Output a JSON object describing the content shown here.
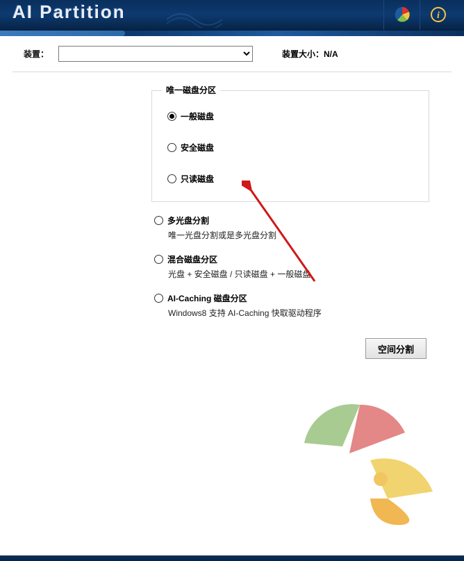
{
  "header": {
    "title": "AI Partition",
    "pie_icon_colors": {
      "r": "#d33",
      "y": "#f5c63f",
      "g": "#7fbf4f",
      "b": "#1e5a9e"
    },
    "info_icon_label": "i"
  },
  "device": {
    "label": "装置：",
    "selected_value": "",
    "size_label": "装置大小：",
    "size_value": "N/A"
  },
  "single_partition": {
    "legend": "唯一磁盘分区",
    "options": [
      {
        "label": "一般磁盘",
        "selected": true
      },
      {
        "label": "安全磁盘",
        "selected": false
      },
      {
        "label": "只读磁盘",
        "selected": false
      }
    ]
  },
  "other_options": [
    {
      "title": "多光盘分割",
      "desc": "唯一光盘分割或是多光盘分割",
      "selected": false
    },
    {
      "title": "混合磁盘分区",
      "desc": "光盘 + 安全磁盘 / 只读磁盘 + 一般磁盘",
      "selected": false
    },
    {
      "title": "AI-Caching 磁盘分区",
      "desc": "Windows8 支持 AI-Caching 快取驱动程序",
      "selected": false
    }
  ],
  "space_button": "空间分割",
  "annotation": {
    "arrow_color": "#d01818"
  }
}
